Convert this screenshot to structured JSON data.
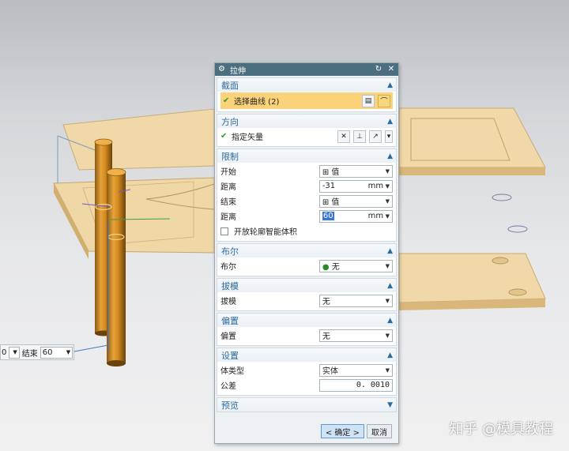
{
  "dialog": {
    "title": "拉伸",
    "sections": {
      "section": {
        "title": "截面",
        "select_curve_label": "选择曲线 (2)"
      },
      "direction": {
        "title": "方向",
        "vector_label": "指定矢量"
      },
      "limits": {
        "title": "限制",
        "start_label": "开始",
        "start_value": "值",
        "distance1_label": "距离",
        "distance1_value": "-31",
        "distance1_unit": "mm",
        "end_label": "结束",
        "end_value": "值",
        "distance2_label": "距离",
        "distance2_value": "60",
        "distance2_unit": "mm",
        "open_profile_label": "开放轮廓智能体积"
      },
      "boolean": {
        "title": "布尔",
        "label": "布尔",
        "value": "无"
      },
      "draft": {
        "title": "拔模",
        "label": "拔模",
        "value": "无"
      },
      "offset": {
        "title": "偏置",
        "label": "偏置",
        "value": "无"
      },
      "settings": {
        "title": "设置",
        "body_type_label": "体类型",
        "body_type_value": "实体",
        "tolerance_label": "公差",
        "tolerance_value": "0. 0010"
      },
      "preview": {
        "title": "预览"
      }
    },
    "ok_label": "< 确定 >",
    "cancel_label": "取消"
  },
  "floatbar": {
    "prefix": "0",
    "label": "结束",
    "value": "60"
  },
  "watermark": "知乎 @模具教程",
  "colors": {
    "titlebar": "#4c6f80",
    "section_title": "#2d6a9f",
    "selection_highlight": "#f9d27a",
    "plate": "#f1d8a8",
    "cylinder": "#d48a1f"
  },
  "icons": {
    "title": "gear-icon",
    "reset": "reset-icon",
    "close": "close-icon",
    "collapse": "chevron-up-icon",
    "expand": "chevron-down-icon",
    "check": "check-icon"
  }
}
